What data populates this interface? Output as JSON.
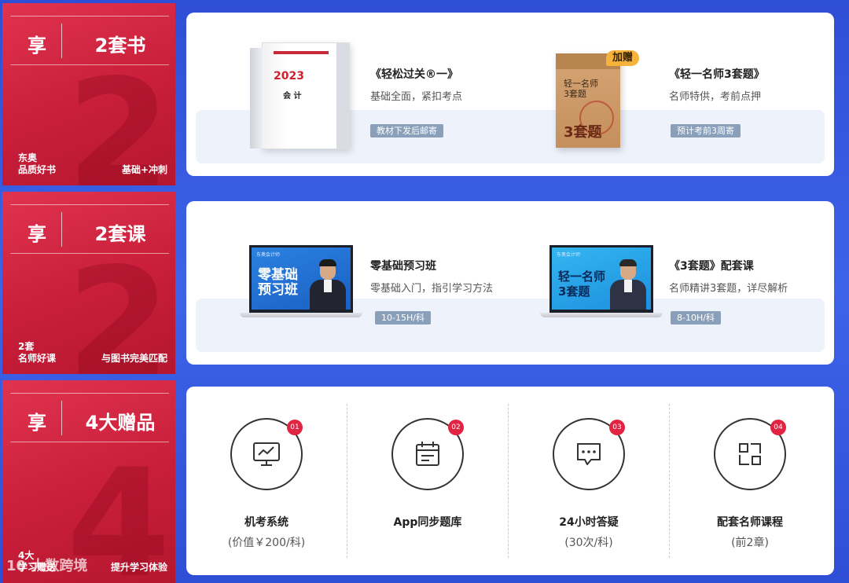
{
  "sections": [
    {
      "xiang": "享",
      "title": "2套书",
      "big_number": "2",
      "footer_left": [
        "东奥",
        "品质好书"
      ],
      "footer_right": "基础+冲刺",
      "items": [
        {
          "title": "《轻松过关®一》",
          "subtitle": "基础全面，紧扣考点",
          "tag": "教材下发后邮寄",
          "cover_year": "2023",
          "cover_name": "会 计"
        },
        {
          "title": "《轻一名师3套题》",
          "subtitle": "名师特供，考前点押",
          "tag": "预计考前3周寄",
          "badge": "加赠",
          "envelope_lines": [
            "轻一名师",
            "3套题"
          ],
          "envelope_big": "3套题"
        }
      ]
    },
    {
      "xiang": "享",
      "title": "2套课",
      "big_number": "2",
      "footer_left": [
        "2套",
        "名师好课"
      ],
      "footer_right": "与图书完美匹配",
      "items": [
        {
          "title": "零基础预习班",
          "subtitle": "零基础入门，指引学习方法",
          "tag": "10-15H/科",
          "screen_title": [
            "零基础",
            "预习班"
          ],
          "screen_top": "东奥会计师"
        },
        {
          "title": "《3套题》配套课",
          "subtitle": "名师精讲3套题，详尽解析",
          "tag": "8-10H/科",
          "screen_title": [
            "轻一名师",
            "3套题"
          ],
          "screen_top": "东奥会计师"
        }
      ]
    },
    {
      "xiang": "享",
      "title": "4大赠品",
      "big_number": "4",
      "footer_left": [
        "4大",
        "学习赠送"
      ],
      "footer_right": "提升学习体验",
      "gifts": [
        {
          "num": "01",
          "icon": "monitor-chart-icon",
          "title": "机考系统",
          "sub": "(价值￥200/科)"
        },
        {
          "num": "02",
          "icon": "calendar-icon",
          "title": "App同步题库",
          "sub": ""
        },
        {
          "num": "03",
          "icon": "chat-bubble-icon",
          "title": "24小时答疑",
          "sub": "(30次/科)"
        },
        {
          "num": "04",
          "icon": "apps-grid-icon",
          "title": "配套名师课程",
          "sub": "(前2章)"
        }
      ]
    }
  ],
  "watermark": "10 大数跨境",
  "colors": {
    "red": "#c81e3a",
    "blue": "#2f4ed6",
    "badge": "#e02442",
    "gold": "#f5b33c"
  }
}
